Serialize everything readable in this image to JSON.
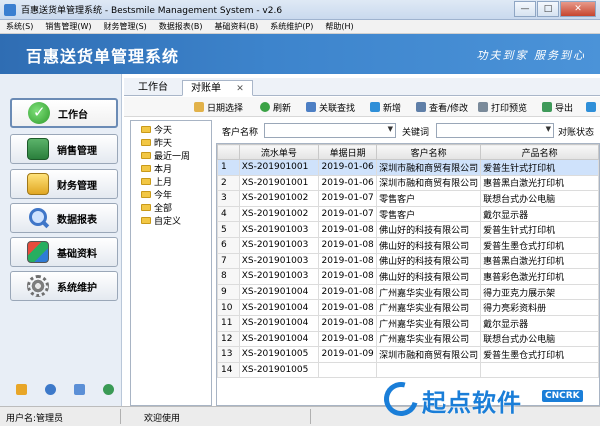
{
  "window": {
    "title": "百惠送货单管理系统 - Bestsmile Management System - v2.6",
    "minimize": "—",
    "maximize": "□",
    "close": "✕"
  },
  "menu": [
    "系统(S)",
    "销售管理(W)",
    "财务管理(S)",
    "数据报表(B)",
    "基础资料(B)",
    "系统维护(P)",
    "帮助(H)"
  ],
  "banner": {
    "title": "百惠送货单管理系统",
    "slogan": "功夫到家 服务到心"
  },
  "nav": [
    {
      "label": "工作台",
      "icon": "check-icon"
    },
    {
      "label": "销售管理",
      "icon": "sales-icon"
    },
    {
      "label": "财务管理",
      "icon": "folder-icon"
    },
    {
      "label": "数据报表",
      "icon": "magnifier-icon"
    },
    {
      "label": "基础资料",
      "icon": "data-icon"
    },
    {
      "label": "系统维护",
      "icon": "gear-icon"
    }
  ],
  "tabs": {
    "workbench": "工作台",
    "statement": "对账单",
    "close": "✕"
  },
  "toolbar": {
    "date_select": "日期选择",
    "refresh": "刷新",
    "related_search": "关联查找",
    "new": "新增",
    "view_edit": "查看/修改",
    "print_preview": "打印预览",
    "export": "导出"
  },
  "tree": [
    "今天",
    "昨天",
    "最近一周",
    "本月",
    "上月",
    "今年",
    "全部",
    "自定义"
  ],
  "filter": {
    "customer_label": "客户名称",
    "keyword_label": "关键词",
    "status_label": "对账状态"
  },
  "table": {
    "headers": [
      "",
      "流水单号",
      "单据日期",
      "客户名称",
      "产品名称"
    ],
    "rows": [
      [
        "1",
        "XS-201901001",
        "2019-01-06",
        "深圳市融和商贸有限公司",
        "爱普生针式打印机"
      ],
      [
        "2",
        "XS-201901001",
        "2019-01-06",
        "深圳市融和商贸有限公司",
        "惠普黑白激光打印机"
      ],
      [
        "3",
        "XS-201901002",
        "2019-01-07",
        "零售客户",
        "联想台式办公电脑"
      ],
      [
        "4",
        "XS-201901002",
        "2019-01-07",
        "零售客户",
        "戴尔显示器"
      ],
      [
        "5",
        "XS-201901003",
        "2019-01-08",
        "佛山好的科技有限公司",
        "爱普生针式打印机"
      ],
      [
        "6",
        "XS-201901003",
        "2019-01-08",
        "佛山好的科技有限公司",
        "爱普生墨仓式打印机"
      ],
      [
        "7",
        "XS-201901003",
        "2019-01-08",
        "佛山好的科技有限公司",
        "惠普黑白激光打印机"
      ],
      [
        "8",
        "XS-201901003",
        "2019-01-08",
        "佛山好的科技有限公司",
        "惠普彩色激光打印机"
      ],
      [
        "9",
        "XS-201901004",
        "2019-01-08",
        "广州嘉华实业有限公司",
        "得力亚克力展示架"
      ],
      [
        "10",
        "XS-201901004",
        "2019-01-08",
        "广州嘉华实业有限公司",
        "得力亮彩资料册"
      ],
      [
        "11",
        "XS-201901004",
        "2019-01-08",
        "广州嘉华实业有限公司",
        "戴尔显示器"
      ],
      [
        "12",
        "XS-201901004",
        "2019-01-08",
        "广州嘉华实业有限公司",
        "联想台式办公电脑"
      ],
      [
        "13",
        "XS-201901005",
        "2019-01-09",
        "深圳市融和商贸有限公司",
        "爱普生墨仓式打印机"
      ],
      [
        "14",
        "XS-201901005",
        "",
        "",
        ""
      ]
    ]
  },
  "status": {
    "user": "用户名:管理员",
    "welcome": "欢迎使用"
  },
  "watermark": {
    "text": "起点软件",
    "badge": "CNCRK"
  },
  "colors": {
    "banner": "#3d84cc",
    "selected_row": "#cfe2fb",
    "watermark": "#1a7ed8"
  }
}
